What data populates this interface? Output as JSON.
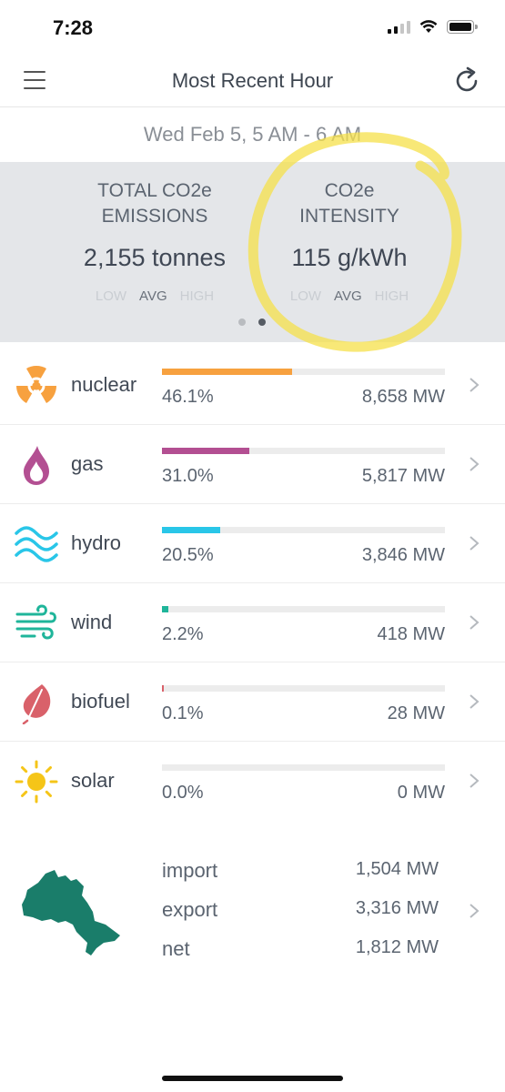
{
  "status_bar": {
    "time": "7:28",
    "icons": [
      "cellular-signal-icon",
      "wifi-icon",
      "battery-icon"
    ]
  },
  "nav": {
    "title": "Most Recent Hour",
    "menu_icon": "hamburger-menu-icon",
    "refresh_icon": "refresh-icon"
  },
  "date_range": "Wed Feb 5, 5 AM - 6 AM",
  "summary": {
    "emissions": {
      "label_line1": "TOTAL CO2e",
      "label_line2": "EMISSIONS",
      "value": "2,155 tonnes",
      "scale": [
        "LOW",
        "AVG",
        "HIGH"
      ],
      "active_level": "AVG"
    },
    "intensity": {
      "label_line1": "CO2e",
      "label_line2": "INTENSITY",
      "value": "115 g/kWh",
      "scale": [
        "LOW",
        "AVG",
        "HIGH"
      ],
      "active_level": "AVG"
    },
    "pager": {
      "pages": 2,
      "active": 2
    },
    "annotation_color": "#f5e04a"
  },
  "sources": [
    {
      "name": "nuclear",
      "percent": "46.1%",
      "share": 0.461,
      "mw": "8,658 MW",
      "color": "#f7a13f",
      "icon": "radiation-icon"
    },
    {
      "name": "gas",
      "percent": "31.0%",
      "share": 0.31,
      "mw": "5,817 MW",
      "color": "#b34f92",
      "icon": "flame-icon"
    },
    {
      "name": "hydro",
      "percent": "20.5%",
      "share": 0.205,
      "mw": "3,846 MW",
      "color": "#29c6e8",
      "icon": "water-waves-icon"
    },
    {
      "name": "wind",
      "percent": "2.2%",
      "share": 0.022,
      "mw": "418 MW",
      "color": "#1fb59a",
      "icon": "wind-icon"
    },
    {
      "name": "biofuel",
      "percent": "0.1%",
      "share": 0.001,
      "mw": "28 MW",
      "color": "#d9616a",
      "icon": "leaf-icon"
    },
    {
      "name": "solar",
      "percent": "0.0%",
      "share": 0.0,
      "mw": "0 MW",
      "color": "#f5c518",
      "icon": "sun-icon"
    }
  ],
  "interchange": {
    "icon": "ontario-map-icon",
    "map_color": "#1a7d6a",
    "rows": [
      {
        "label": "import",
        "value": "1,504 MW"
      },
      {
        "label": "export",
        "value": "3,316 MW"
      },
      {
        "label": "net",
        "value": "1,812 MW"
      }
    ]
  }
}
